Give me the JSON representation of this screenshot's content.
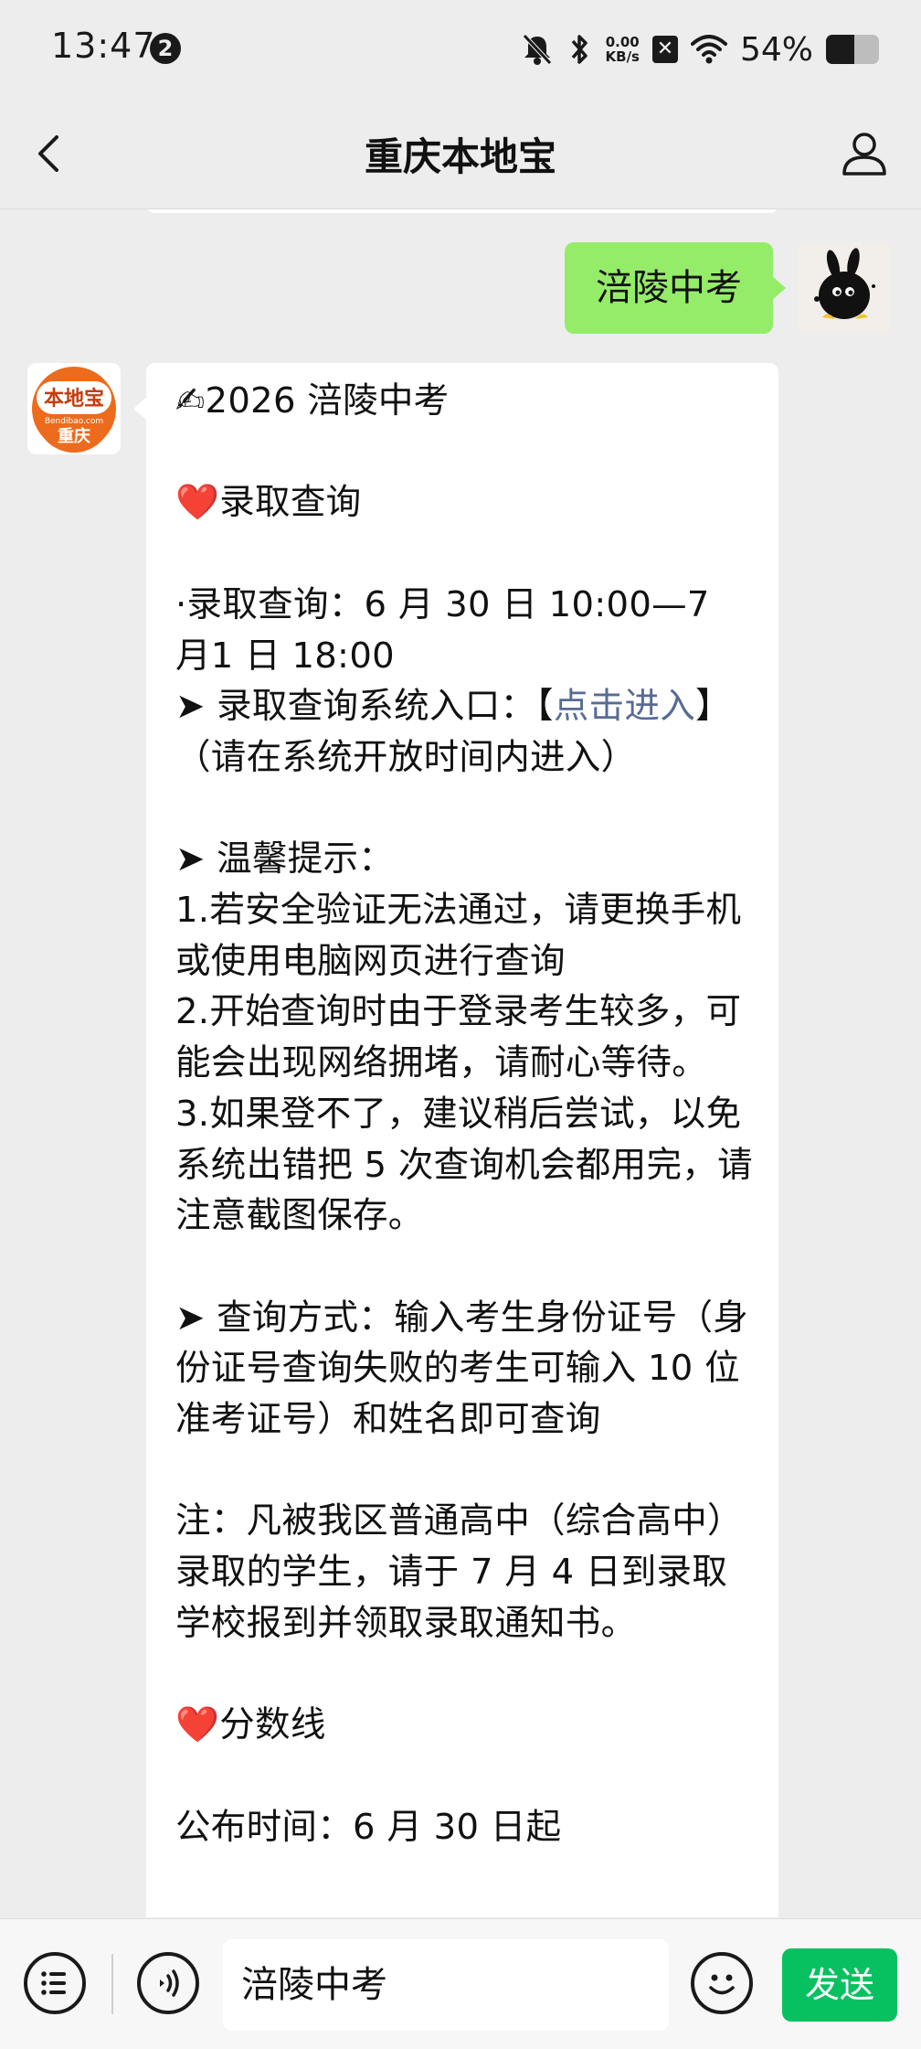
{
  "status_bar": {
    "time": "13:47",
    "notification_count": "2",
    "net_speed_value": "0.00",
    "net_speed_unit": "KB/s",
    "battery_percent": "54%",
    "battery_level": 0.54
  },
  "nav": {
    "title": "重庆本地宝"
  },
  "chat": {
    "my_message": "涪陵中考",
    "bot_avatar_logo_text": "本地宝",
    "bot_avatar_site": "Bendibao.com",
    "bot_avatar_city": "重庆",
    "bot_message": {
      "p1": "✍2026 涪陵中考\n\n",
      "heart1": "❤️",
      "p2": "录取查询\n\n·录取查询：6 月 30 日 10:00—7 月1 日 18:00\n➤ 录取查询系统入口：【",
      "link": "点击进入",
      "p3": "】（请在系统开放时间内进入）\n\n➤ 温馨提示：\n1.若安全验证无法通过，请更换手机或使用电脑网页进行查询\n2.开始查询时由于登录考生较多，可能会出现网络拥堵，请耐心等待。\n3.如果登不了，建议稍后尝试，以免系统出错把 5 次查询机会都用完，请注意截图保存。\n\n➤ 查询方式：输入考生身份证号（身份证号查询失败的考生可输入 10 位准考证号）和姓名即可查询\n\n注：凡被我区普通高中（综合高中）录取的学生，请于 7 月 4 日到录取学校报到并领取录取通知书。\n\n",
      "heart2": "❤️",
      "p4": "分数线\n\n公布时间：6 月 30 日起"
    }
  },
  "input_bar": {
    "input_value": "涪陵中考",
    "send_label": "发送"
  },
  "colors": {
    "my_bubble": "#95ec69",
    "send_button": "#07c160",
    "link": "#576b95",
    "background": "#ededed"
  },
  "icons": [
    "notification-badge-icon",
    "mute-bell-icon",
    "bluetooth-icon",
    "wifi-icon",
    "battery-icon",
    "back-icon",
    "profile-icon",
    "menu-list-icon",
    "voice-icon",
    "emoji-icon"
  ]
}
